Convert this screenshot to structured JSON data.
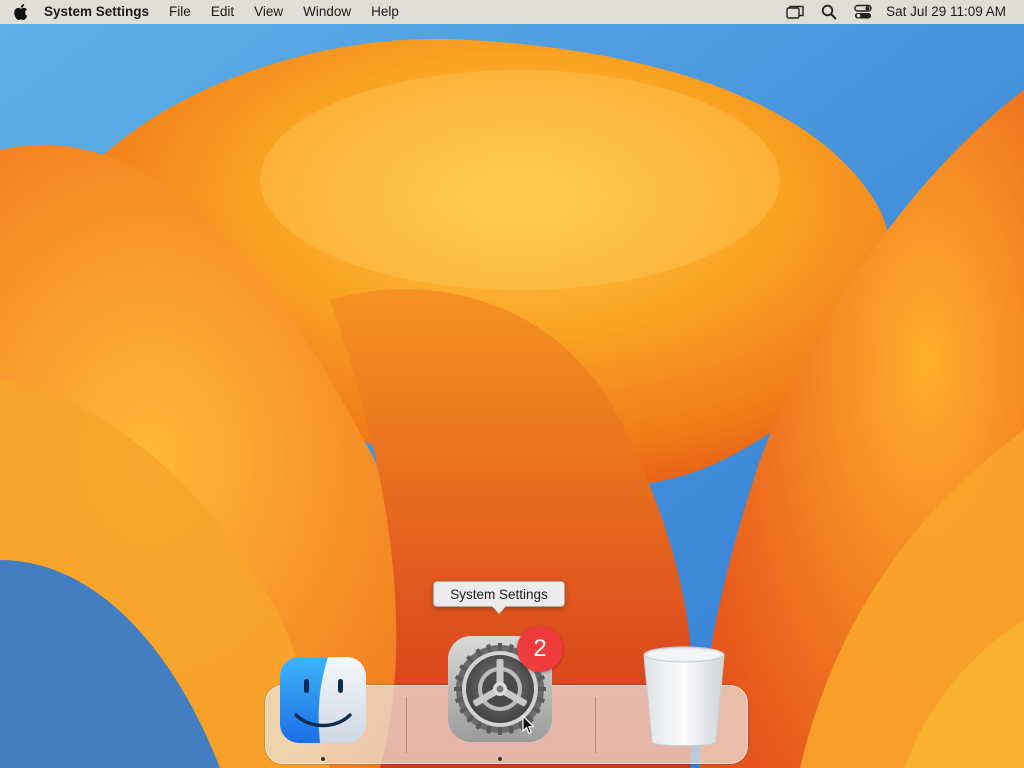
{
  "menubar": {
    "apple_icon": "apple-logo-icon",
    "app_name": "System Settings",
    "menus": [
      "File",
      "Edit",
      "View",
      "Window",
      "Help"
    ],
    "status_icons": [
      "screen-mirroring-icon",
      "spotlight-search-icon",
      "control-center-icon"
    ],
    "clock": "Sat Jul 29  11:09 AM"
  },
  "dock": {
    "items": [
      {
        "name": "Finder",
        "icon": "finder-icon",
        "running": true
      },
      {
        "name": "System Settings",
        "icon": "system-settings-icon",
        "running": true,
        "badge": "2"
      },
      {
        "name": "Trash",
        "icon": "trash-icon",
        "running": false
      }
    ],
    "tooltip": "System Settings"
  },
  "colors": {
    "badge": "#ef3b3b",
    "wallpaper_primary": "#f7a21c",
    "wallpaper_sky": "#3a86d4"
  }
}
